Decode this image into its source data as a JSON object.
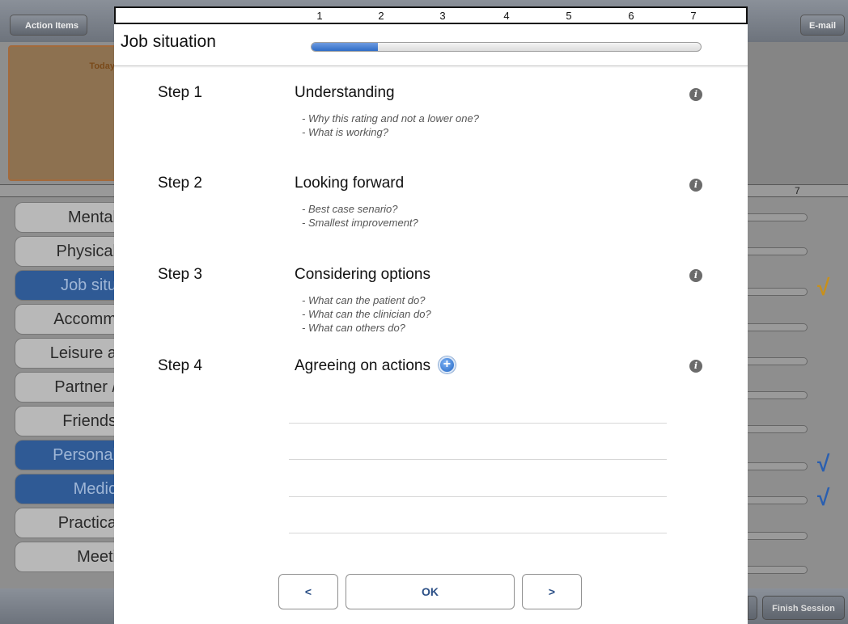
{
  "background": {
    "nav": {
      "back_label": "Action Items",
      "email_label": "E-mail"
    },
    "today_label": "Today",
    "scale_end_label": "7",
    "domains": [
      {
        "label": "Mental",
        "selected": false
      },
      {
        "label": "Physical",
        "selected": false
      },
      {
        "label": "Job situ",
        "selected": true
      },
      {
        "label": "Accomm",
        "selected": false
      },
      {
        "label": "Leisure a",
        "selected": false
      },
      {
        "label": "Partner /",
        "selected": false
      },
      {
        "label": "Friends",
        "selected": false
      },
      {
        "label": "Personal",
        "selected": true
      },
      {
        "label": "Medic",
        "selected": true
      },
      {
        "label": "Practica",
        "selected": false
      },
      {
        "label": "Meeti",
        "selected": false
      }
    ],
    "checkmark_glyph": "√",
    "checkmark_colors": {
      "job": "#c8901c",
      "personal": "#2a5fb0",
      "medical": "#2a5fb0"
    },
    "finish_label": "Finish Session"
  },
  "modal": {
    "ruler_numbers": [
      "1",
      "2",
      "3",
      "4",
      "5",
      "6",
      "7"
    ],
    "title": "Job situation",
    "progress_fraction": 0.17,
    "steps": [
      {
        "label": "Step 1",
        "title": "Understanding",
        "prompts": [
          "- Why this rating and not a lower one?",
          "- What is working?"
        ]
      },
      {
        "label": "Step 2",
        "title": "Looking forward",
        "prompts": [
          "- Best case senario?",
          "- Smallest improvement?"
        ]
      },
      {
        "label": "Step 3",
        "title": "Considering options",
        "prompts": [
          "- What can the patient do?",
          "- What can the clinician do?",
          "- What can others do?"
        ]
      },
      {
        "label": "Step 4",
        "title": "Agreeing on actions",
        "prompts": []
      }
    ],
    "info_glyph": "i",
    "add_glyph": "+",
    "footer": {
      "prev_label": "<",
      "ok_label": "OK",
      "next_label": ">"
    },
    "accent_color": "#2f6cc6"
  }
}
